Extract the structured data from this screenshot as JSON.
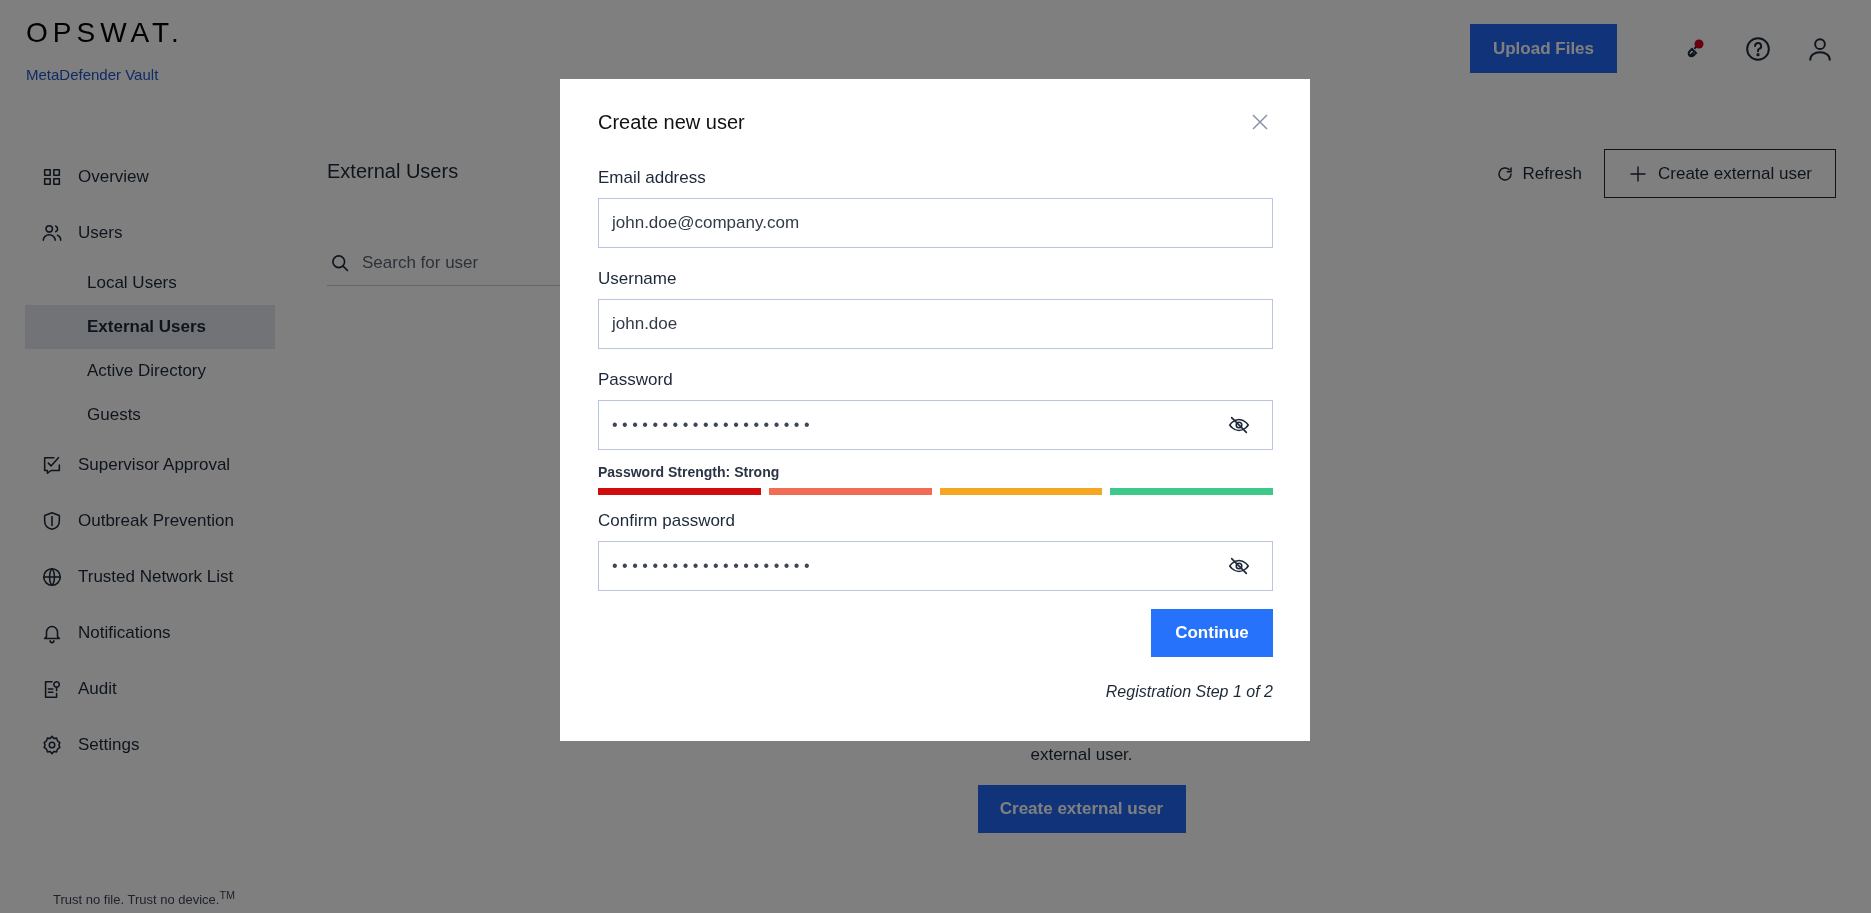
{
  "brand": {
    "logo": "OPSWAT.",
    "product": "MetaDefender Vault"
  },
  "header": {
    "upload_button": "Upload Files",
    "notification_badge": true
  },
  "sidebar": {
    "items": [
      {
        "label": "Overview",
        "selected": false
      },
      {
        "label": "Users",
        "selected": false,
        "children": [
          {
            "label": "Local Users",
            "selected": false
          },
          {
            "label": "External Users",
            "selected": true
          },
          {
            "label": "Active Directory",
            "selected": false
          },
          {
            "label": "Guests",
            "selected": false
          }
        ]
      },
      {
        "label": "Supervisor Approval",
        "selected": false
      },
      {
        "label": "Outbreak Prevention",
        "selected": false
      },
      {
        "label": "Trusted Network List",
        "selected": false
      },
      {
        "label": "Notifications",
        "selected": false
      },
      {
        "label": "Audit",
        "selected": false
      },
      {
        "label": "Settings",
        "selected": false
      }
    ],
    "footer": "Trust no file. Trust no device.$^{TM}$"
  },
  "content": {
    "title": "External Users",
    "refresh": "Refresh",
    "create_button": "Create external user",
    "search": {
      "placeholder": "Search for user"
    },
    "empty_state": {
      "text": "external user.",
      "button": "Create external user"
    }
  },
  "dialog": {
    "title": "Create new user",
    "fields": [
      {
        "label": "Email address",
        "value": "john.doe@company.com",
        "kind": "text"
      },
      {
        "label": "Username",
        "value": "john.doe",
        "kind": "text"
      },
      {
        "label": "Password",
        "value": "••••••••••••••••••••",
        "kind": "password"
      },
      {
        "label": "Confirm password",
        "value": "••••••••••••••••••••",
        "kind": "password"
      }
    ],
    "strength": {
      "label": "Password Strength: Strong",
      "bars": [
        {
          "color": "#d00c0c"
        },
        {
          "color": "#f26b55"
        },
        {
          "color": "#f5a623"
        },
        {
          "color": "#3cc98a"
        }
      ]
    },
    "continue_button": "Continue",
    "step": "Registration Step 1 of 2"
  }
}
